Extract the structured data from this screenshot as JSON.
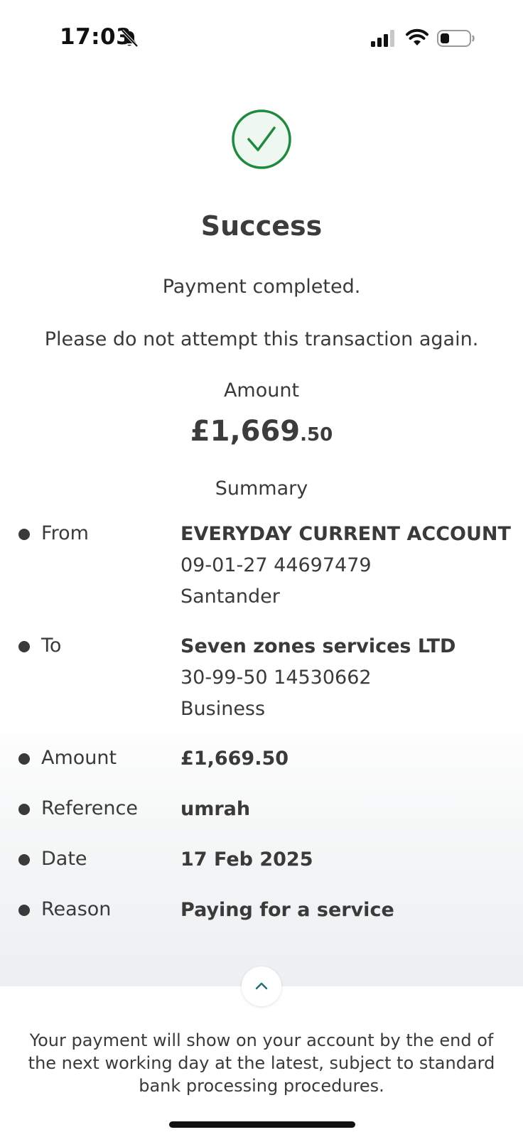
{
  "status_bar": {
    "time": "17:03",
    "icons": [
      "bell-off-icon",
      "signal-icon",
      "wifi-icon",
      "battery-icon"
    ]
  },
  "success": {
    "icon": "check-circle-icon",
    "title": "Success",
    "message": "Payment completed.",
    "warning": "Please do not attempt this transaction again."
  },
  "amount": {
    "label": "Amount",
    "main": "£1,669",
    "pence": ".50"
  },
  "summary": {
    "heading": "Summary",
    "from": {
      "label": "From",
      "account_name": "EVERYDAY CURRENT ACCOUNT",
      "account_number": "09-01-27 44697479",
      "bank": "Santander"
    },
    "to": {
      "label": "To",
      "name": "Seven zones services LTD",
      "account_number": "30-99-50 14530662",
      "type": "Business"
    },
    "amount": {
      "label": "Amount",
      "value": "£1,669.50"
    },
    "reference": {
      "label": "Reference",
      "value": "umrah"
    },
    "date": {
      "label": "Date",
      "value": "17 Feb 2025"
    },
    "reason": {
      "label": "Reason",
      "value": "Paying for a service"
    }
  },
  "collapse_button": {
    "icon": "chevron-up-icon"
  },
  "footer": {
    "note": "Your payment will show on your account by the end of the next working day at the latest, subject to standard bank processing procedures."
  },
  "colors": {
    "success_green": "#1e8a3c",
    "accent_teal": "#1f6f7a",
    "text_dark": "#3a3a3a"
  }
}
